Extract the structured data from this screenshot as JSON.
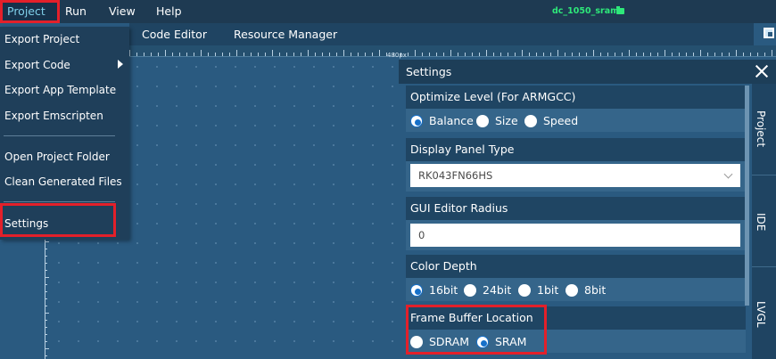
{
  "menubar": {
    "items": [
      "Project",
      "Run",
      "View",
      "Help"
    ],
    "project_title": "dc_1050_sram"
  },
  "tabs": [
    "Code Editor",
    "Resource Manager"
  ],
  "ruler": {
    "label": "480px"
  },
  "project_menu": {
    "items": [
      "Export Project",
      "Export Code",
      "Export App Template",
      "Export Emscripten",
      "Open Project Folder",
      "Clean Generated Files",
      "Settings"
    ]
  },
  "settings": {
    "title": "Settings",
    "optimize": {
      "title": "Optimize Level (For ARMGCC)",
      "options": [
        "Balance",
        "Size",
        "Speed"
      ],
      "selected": "Balance"
    },
    "display_panel": {
      "title": "Display Panel Type",
      "value": "RK043FN66HS"
    },
    "gui_radius": {
      "title": "GUI Editor Radius",
      "value": "0"
    },
    "color_depth": {
      "title": "Color Depth",
      "options": [
        "16bit",
        "24bit",
        "1bit",
        "8bit"
      ],
      "selected": "16bit"
    },
    "frame_buffer": {
      "title": "Frame Buffer Location",
      "options": [
        "SDRAM",
        "SRAM"
      ],
      "selected": "SRAM"
    }
  },
  "side_tabs": [
    "Project",
    "IDE",
    "LVGL"
  ],
  "colors": {
    "highlight_box": "#e3202a",
    "project_title": "#2ee87a",
    "radio_checked": "#1670c9"
  }
}
